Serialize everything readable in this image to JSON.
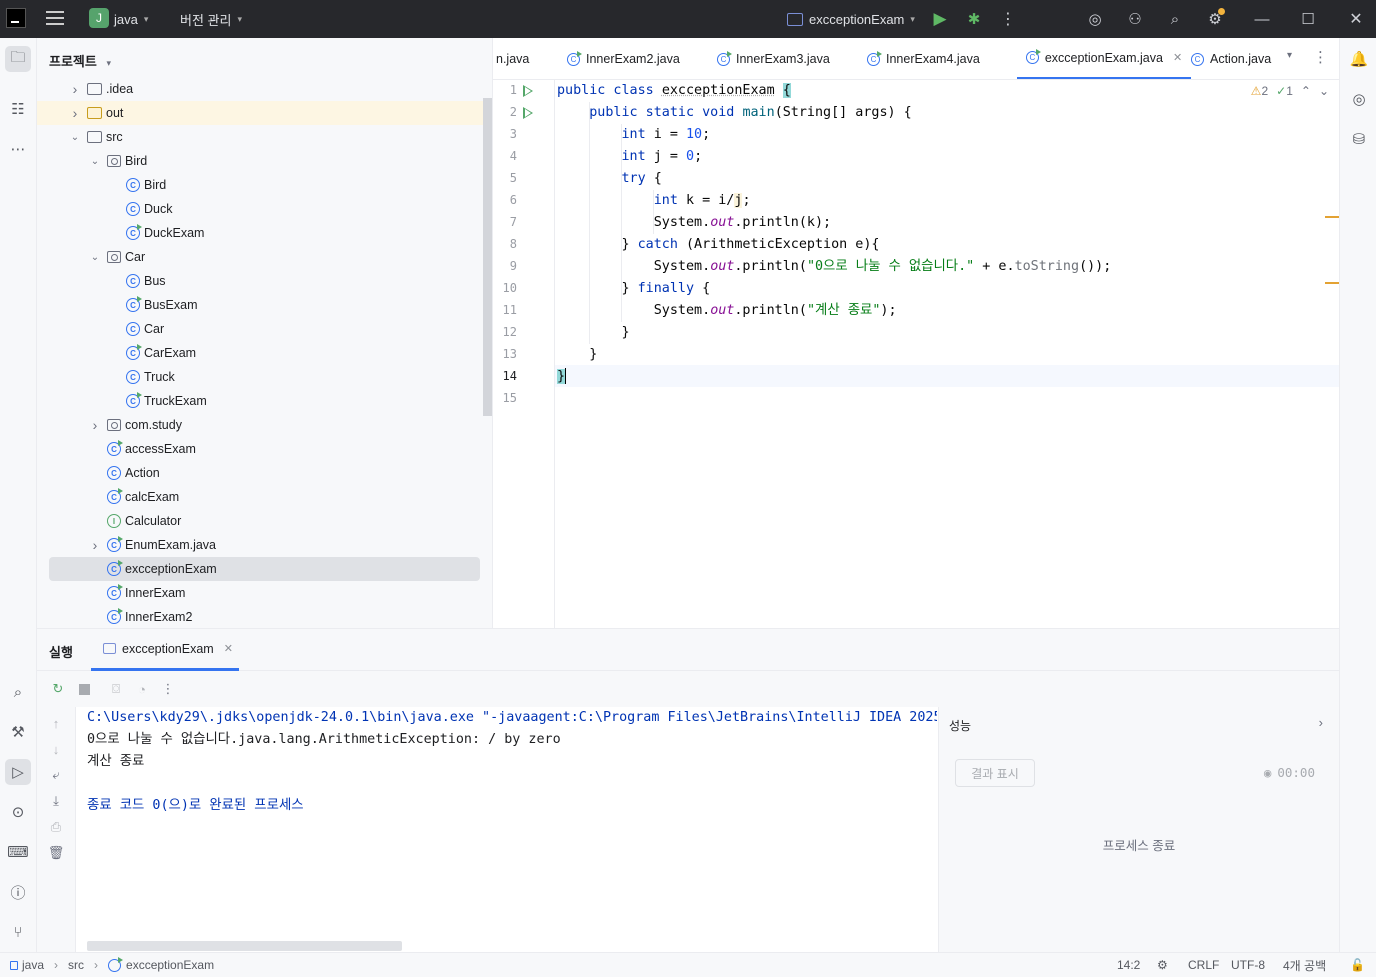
{
  "titlebar": {
    "project_initial": "J",
    "project_name": "java",
    "vcs_menu": "버전 관리",
    "run_config": "excceptionExam"
  },
  "project_panel": {
    "title": "프로젝트",
    "tree": [
      {
        "label": ".idea",
        "type": "folder",
        "depth": 1,
        "expanded": false
      },
      {
        "label": "out",
        "type": "folder-excluded",
        "depth": 1,
        "expanded": false
      },
      {
        "label": "src",
        "type": "folder",
        "depth": 1,
        "expanded": true
      },
      {
        "label": "Bird",
        "type": "package",
        "depth": 2,
        "expanded": true
      },
      {
        "label": "Bird",
        "type": "class",
        "depth": 3
      },
      {
        "label": "Duck",
        "type": "class",
        "depth": 3
      },
      {
        "label": "DuckExam",
        "type": "runnable",
        "depth": 3
      },
      {
        "label": "Car",
        "type": "package",
        "depth": 2,
        "expanded": true
      },
      {
        "label": "Bus",
        "type": "class",
        "depth": 3
      },
      {
        "label": "BusExam",
        "type": "runnable",
        "depth": 3
      },
      {
        "label": "Car",
        "type": "class",
        "depth": 3
      },
      {
        "label": "CarExam",
        "type": "runnable",
        "depth": 3
      },
      {
        "label": "Truck",
        "type": "class",
        "depth": 3
      },
      {
        "label": "TruckExam",
        "type": "runnable",
        "depth": 3
      },
      {
        "label": "com.study",
        "type": "package",
        "depth": 2,
        "expanded": false
      },
      {
        "label": "accessExam",
        "type": "runnable",
        "depth": 2
      },
      {
        "label": "Action",
        "type": "class",
        "depth": 2
      },
      {
        "label": "calcExam",
        "type": "runnable",
        "depth": 2
      },
      {
        "label": "Calculator",
        "type": "interface",
        "depth": 2
      },
      {
        "label": "EnumExam.java",
        "type": "runnable",
        "depth": 2,
        "expanded": false
      },
      {
        "label": "excceptionExam",
        "type": "runnable",
        "depth": 2,
        "selected": true
      },
      {
        "label": "InnerExam",
        "type": "runnable",
        "depth": 2
      },
      {
        "label": "InnerExam2",
        "type": "runnable",
        "depth": 2
      }
    ]
  },
  "editor": {
    "tabs": [
      {
        "label": "n.java"
      },
      {
        "label": "InnerExam2.java"
      },
      {
        "label": "InnerExam3.java"
      },
      {
        "label": "InnerExam4.java"
      },
      {
        "label": "excceptionExam.java",
        "active": true
      },
      {
        "label": "Action.java"
      }
    ],
    "warnings": "2",
    "checks": "1",
    "line_numbers": [
      "1",
      "2",
      "3",
      "4",
      "5",
      "6",
      "7",
      "8",
      "9",
      "10",
      "11",
      "12",
      "13",
      "14",
      "15"
    ]
  },
  "run_panel": {
    "title": "실행",
    "tab": "excceptionExam",
    "console": [
      "C:\\Users\\kdy29\\.jdks\\openjdk-24.0.1\\bin\\java.exe \"-javaagent:C:\\Program Files\\JetBrains\\IntelliJ IDEA 2025",
      "0으로 나눌 수 없습니다.java.lang.ArithmeticException: / by zero",
      "계산 종료",
      "",
      "종료 코드 0(으)로 완료된 프로세스"
    ],
    "perf_title": "성능",
    "show_results_button": "결과 표시",
    "timer": "00:00",
    "process_status": "프로세스 종료"
  },
  "statusbar": {
    "crumbs": [
      "java",
      "src",
      "excceptionExam"
    ],
    "position": "14:2",
    "line_ending": "CRLF",
    "encoding": "UTF-8",
    "indent": "4개 공백"
  }
}
